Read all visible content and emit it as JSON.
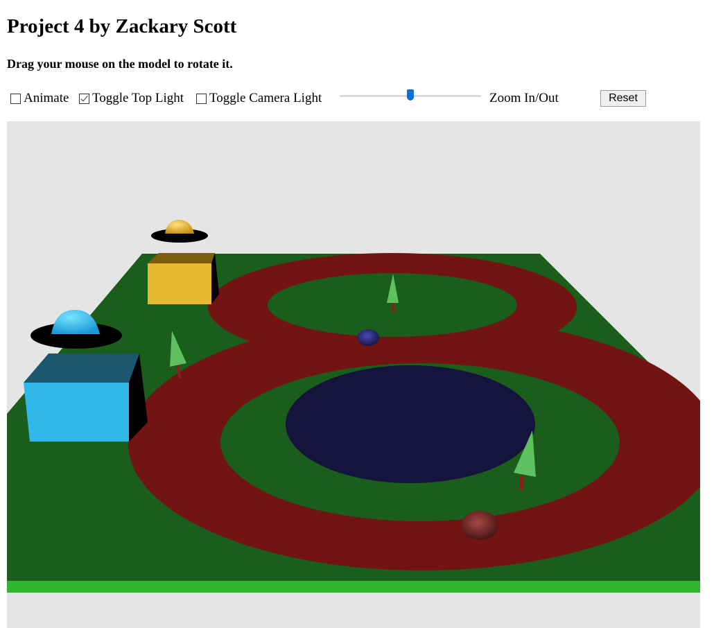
{
  "header": {
    "title": "Project 4 by Zackary Scott",
    "instructions": "Drag your mouse on the model to rotate it."
  },
  "controls": {
    "animate": {
      "label": "Animate",
      "checked": false
    },
    "top_light": {
      "label": "Toggle Top Light",
      "checked": true
    },
    "camera_light": {
      "label": "Toggle Camera Light",
      "checked": false
    },
    "zoom": {
      "label": "Zoom In/Out",
      "value": 0.5
    },
    "reset_label": "Reset"
  },
  "scene": {
    "colors": {
      "background": "#e5e5e5",
      "ground": "#1b5d1b",
      "ground_edge": "#2fb52f",
      "track": "#721414",
      "pond": "#14143c",
      "ball_blue": "#2a2a80",
      "ball_red": "#7a2a2a",
      "building_yellow": "#e8b830",
      "building_blue": "#30b8e8",
      "tree": "#5fc060",
      "trunk": "#8a1e1e"
    },
    "icons": [
      "ufo-yellow-icon",
      "ufo-blue-icon",
      "tree-icon",
      "ball-icon"
    ]
  }
}
